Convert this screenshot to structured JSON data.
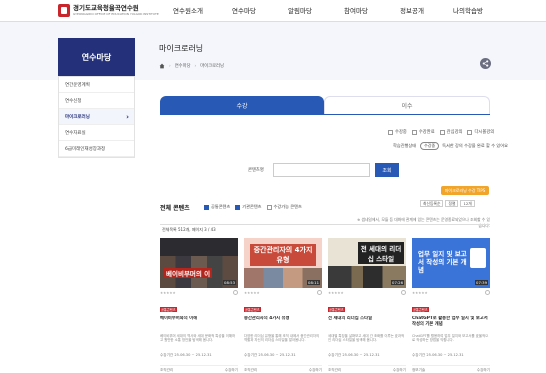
{
  "header": {
    "logo_title": "경기도교육청율곡연수원",
    "logo_subtitle": "GYEONGGIDO OFFICE OF EDUCATION YULGOK INSTITUTE",
    "gnb": [
      "연수원소개",
      "연수마당",
      "알림마당",
      "참여마당",
      "정보공개",
      "나의학습방"
    ]
  },
  "sidebar": {
    "title": "연수마당",
    "items": [
      {
        "label": "연간운영계획"
      },
      {
        "label": "연수신청"
      },
      {
        "label": "마이크로러닝"
      },
      {
        "label": "연수자료실"
      },
      {
        "label": "6급미래인재성장과정"
      }
    ]
  },
  "page": {
    "title": "마이크로러닝",
    "breadcrumb": [
      "연수마당",
      "마이크로러닝"
    ]
  },
  "tabs": [
    {
      "label": "수강"
    },
    {
      "label": "이수"
    }
  ],
  "filters": {
    "row1": [
      "수강중",
      "수강완료",
      "관심강의",
      "다시볼강의"
    ],
    "row2_label": "학습진행상태",
    "row2_pill": "수강중",
    "row2_text": "독서한 강의 수강을 완료 할 수 있어요"
  },
  "search": {
    "label": "콘텐츠명",
    "placeholder": "",
    "button": "조회"
  },
  "badge_button": "마이크로러닝 수강 TIPS",
  "section": {
    "title": "전체 콘텐츠",
    "checks": [
      {
        "label": "공통콘텐츠",
        "checked": true
      },
      {
        "label": "기관콘텐츠",
        "checked": true
      },
      {
        "label": "수강가능 콘텐츠",
        "checked": false
      }
    ],
    "sort": [
      "최신등록순",
      "정렬",
      "12개"
    ],
    "notice": "※ 썸네일에서, 모듈 등 대화에 관계에 있는 콘텐츠는 운영종료되었으나 조회할 수 있습니다.",
    "count": "전체목록 512개, 페이지 3 / 43"
  },
  "cards": [
    {
      "thumb_title": "베이비부머의 이",
      "duration": "08:53",
      "tag": "공통콘텐츠",
      "title": "베이비부머와의 이해",
      "desc": "베이비부머 세대의 역사와 세대 문화적 특성을 이해하고 원만한 소통 방안을 탐색해 봅니다.",
      "date": "수강기간 25.06.30 ~ 25.12.31",
      "foot_left": "조직관리",
      "foot_right": "수강하기"
    },
    {
      "thumb_title": "중간관리자의 4가지 유형",
      "duration": "08:11",
      "tag": "공통콘텐츠",
      "title": "중간관리자의 4가지 유형",
      "desc": "다양한 리더십 유형을 통해 조직 내에서 중간관리자의 역할과 자신의 리더십 스타일을 알아봅니다.",
      "date": "수강기간 25.06.30 ~ 25.12.31",
      "foot_left": "조직관리",
      "foot_right": "수강하기"
    },
    {
      "thumb_title": "전 세대의 리더십 스타일",
      "duration": "07:26",
      "tag": "공통콘텐츠",
      "title": "전 세대의 리더십 스타일",
      "desc": "세대별 특징을 살펴보고 세대 간 조화를 이루는 효과적인 리더십 스타일을 탐색해 봅니다.",
      "date": "수강기간 25.06.30 ~ 25.12.31",
      "foot_left": "조직관리",
      "foot_right": "수강하기"
    },
    {
      "thumb_title": "업무 일지 및 보고서 작성의 기본 개념",
      "duration": "07:39",
      "tag": "공통콘텐츠",
      "title": "ChatGPT로 활용한 업무 일지 및 보고서 작성의 기본 개념",
      "desc": "ChatGPT를 활용하여 업무 일지와 보고서를 효율적으로 작성하는 방법을 익힙니다.",
      "date": "수강기간 25.06.30 ~ 25.12.31",
      "foot_left": "정보기술",
      "foot_right": "수강하기"
    }
  ],
  "colors": {
    "brand": "#24317a",
    "accent": "#2759b5",
    "tip": "#f1a52b",
    "tag": "#c9252d"
  }
}
